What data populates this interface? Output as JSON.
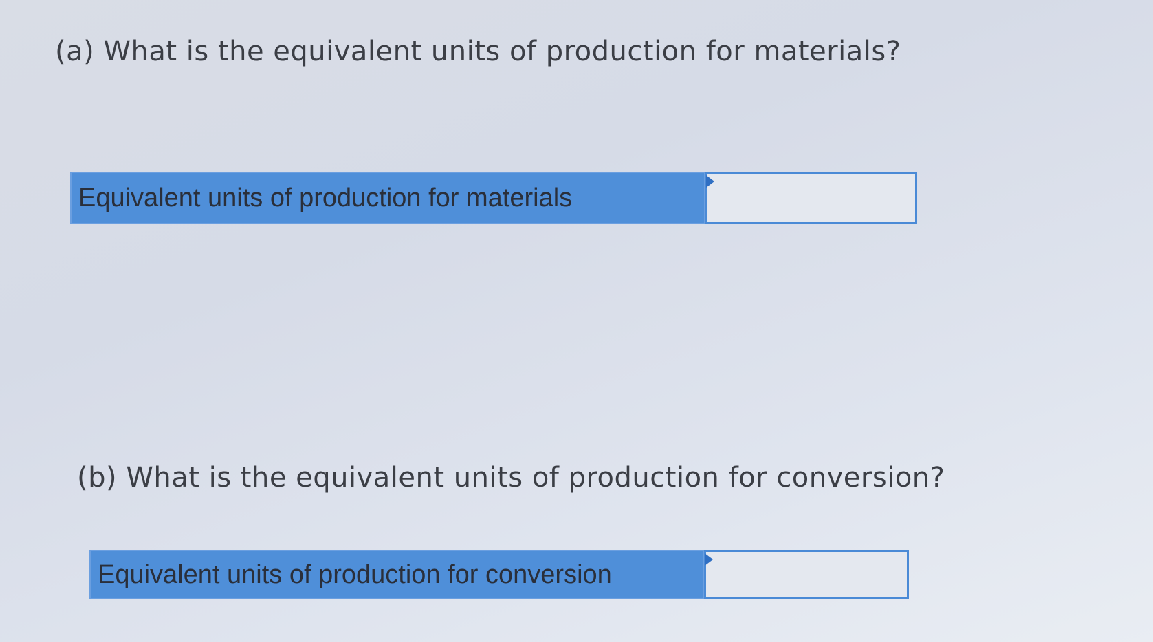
{
  "questions": {
    "a": {
      "prompt": "(a) What is the equivalent units of production for materials?",
      "answer_label": "Equivalent units of production for materials",
      "answer_value": ""
    },
    "b": {
      "prompt": "(b) What is the equivalent units of production for conversion?",
      "answer_label": "Equivalent units of production for conversion",
      "answer_value": ""
    }
  },
  "colors": {
    "label_background": "#4f8fd9",
    "input_border": "#4a8ad6",
    "page_background": "#dbe0ea"
  },
  "icons": {
    "input_marker": "flag-marker-icon"
  }
}
